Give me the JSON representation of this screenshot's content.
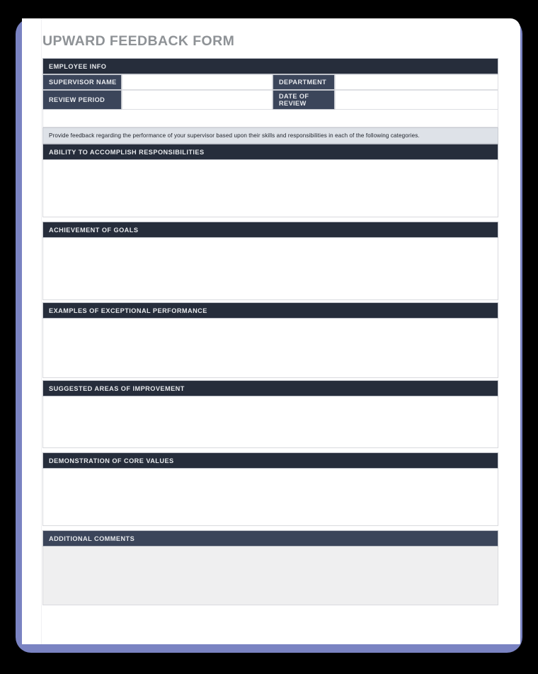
{
  "document": {
    "title": "UPWARD FEEDBACK FORM"
  },
  "employee_info": {
    "section_header": "EMPLOYEE INFO",
    "fields": [
      {
        "label": "SUPERVISOR NAME",
        "value": ""
      },
      {
        "label": "DEPARTMENT",
        "value": ""
      },
      {
        "label": "REVIEW PERIOD",
        "value": ""
      },
      {
        "label": "DATE OF REVIEW",
        "value": ""
      }
    ]
  },
  "instruction": {
    "text": "Provide feedback regarding the performance of your supervisor based upon their skills and responsibilities in each of the following categories."
  },
  "sections": [
    {
      "header": "ABILITY TO ACCOMPLISH RESPONSIBILITIES",
      "response": ""
    },
    {
      "header": "ACHIEVEMENT OF GOALS",
      "response": ""
    },
    {
      "header": "EXAMPLES OF EXCEPTIONAL PERFORMANCE",
      "response": ""
    },
    {
      "header": "SUGGESTED AREAS OF IMPROVEMENT",
      "response": ""
    },
    {
      "header": "DEMONSTRATION OF CORE VALUES",
      "response": ""
    },
    {
      "header": "ADDITIONAL COMMENTS",
      "response": ""
    }
  ],
  "colors": {
    "header_dark": "#262d3b",
    "header_slate": "#3b455a",
    "label_cell": "#3b455a",
    "instruction_band": "#dee2e8",
    "title_gray": "#8e9296",
    "frame_periwinkle": "#7a83c2",
    "comments_fill": "#efeff0",
    "page_background": "#ffffff",
    "canvas": "#000000"
  }
}
